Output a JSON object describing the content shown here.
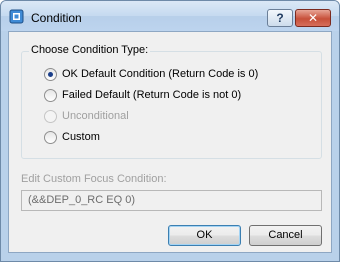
{
  "window": {
    "title": "Condition",
    "help_label": "?",
    "close_label": "✕"
  },
  "condition_group": {
    "legend": "Choose Condition Type:",
    "options": [
      {
        "label": "OK Default Condition (Return Code is 0)",
        "checked": true,
        "enabled": true
      },
      {
        "label": "Failed Default (Return Code is not 0)",
        "checked": false,
        "enabled": true
      },
      {
        "label": "Unconditional",
        "checked": false,
        "enabled": false
      },
      {
        "label": "Custom",
        "checked": false,
        "enabled": true
      }
    ]
  },
  "custom_condition": {
    "label": "Edit Custom Focus Condition:",
    "value": "(&&DEP_0_RC EQ 0)"
  },
  "buttons": {
    "ok": "OK",
    "cancel": "Cancel"
  }
}
